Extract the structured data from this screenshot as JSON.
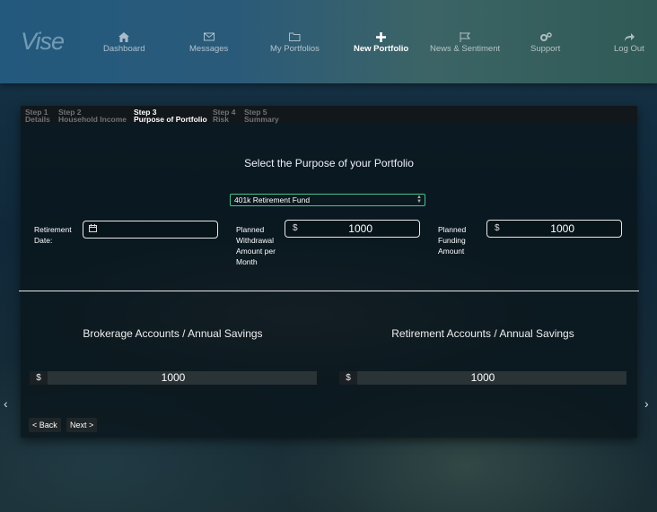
{
  "brand": "Vise",
  "nav": [
    {
      "label": "Dashboard",
      "icon": "home-icon"
    },
    {
      "label": "Messages",
      "icon": "envelope-icon"
    },
    {
      "label": "My Portfolios",
      "icon": "folder-icon"
    },
    {
      "label": "New Portfolio",
      "icon": "plus-icon"
    },
    {
      "label": "News & Sentiment",
      "icon": "flag-icon"
    },
    {
      "label": "Support",
      "icon": "gears-icon"
    },
    {
      "label": "Log Out",
      "icon": "share-icon"
    }
  ],
  "steps": [
    {
      "num": "Step 1",
      "label": "Details"
    },
    {
      "num": "Step 2",
      "label": "Household Income"
    },
    {
      "num": "Step 3",
      "label": "Purpose of Portfolio"
    },
    {
      "num": "Step 4",
      "label": "Risk"
    },
    {
      "num": "Step 5",
      "label": "Summary"
    }
  ],
  "heading": "Select the Purpose of your Portfolio",
  "purpose_select": {
    "value": "401k Retirement Fund"
  },
  "retirement_date": {
    "label": "Retirement Date:",
    "value": ""
  },
  "withdrawal": {
    "label": "Planned Withdrawal Amount per Month",
    "currency": "$",
    "value": "1000"
  },
  "funding": {
    "label": "Planned Funding Amount",
    "currency": "$",
    "value": "1000"
  },
  "brokerage": {
    "title": "Brokerage Accounts / Annual Savings",
    "currency": "$",
    "value": "1000"
  },
  "retirement_accounts": {
    "title": "Retirement Accounts / Annual Savings",
    "currency": "$",
    "value": "1000"
  },
  "buttons": {
    "back": "< Back",
    "next": "Next >"
  },
  "carousel": {
    "prev": "‹",
    "next": "›"
  },
  "colors": {
    "accent_green": "#4fbf8c",
    "nav_blue": "#23597d"
  }
}
